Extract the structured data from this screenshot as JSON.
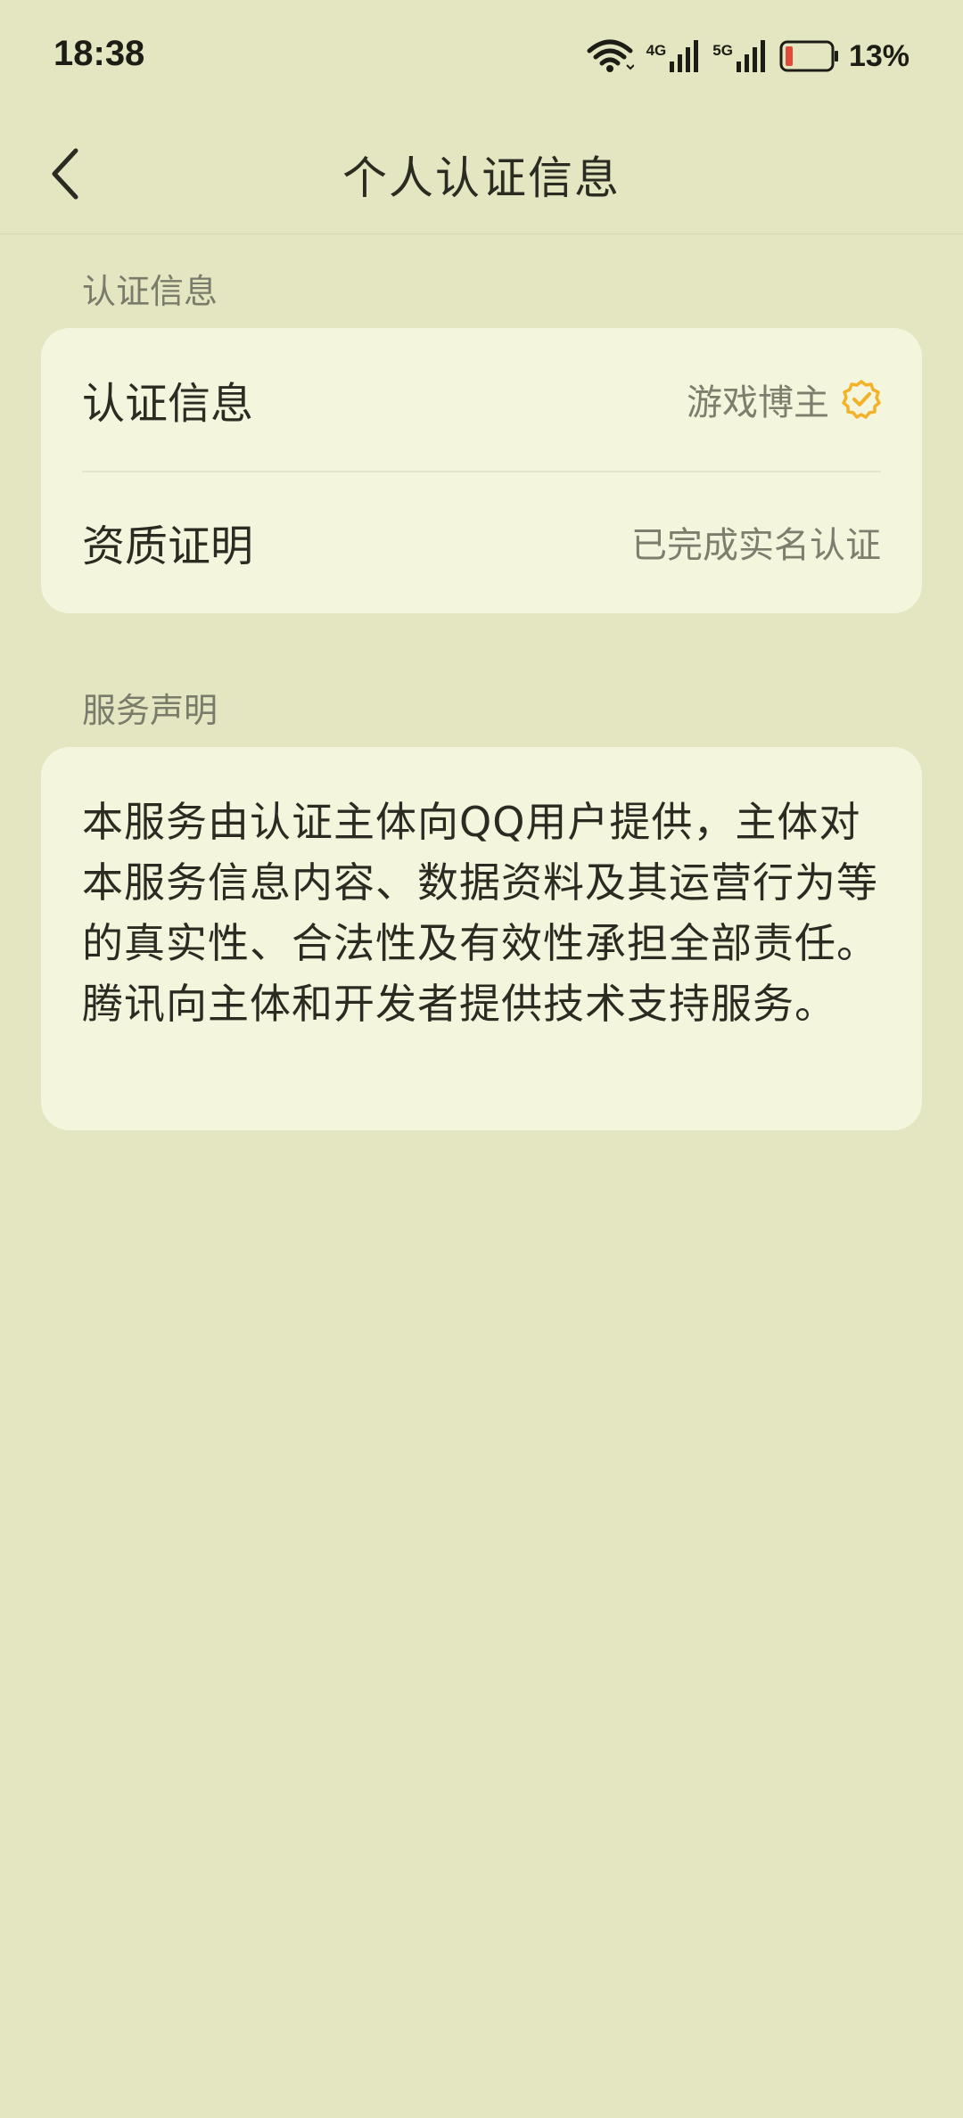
{
  "status_bar": {
    "time": "18:38",
    "net_4g": "4G",
    "net_5g": "5G",
    "battery_percent": "13%",
    "icons": [
      "wifi-icon",
      "cell-signal-4g-icon",
      "cell-signal-5g-icon",
      "battery-low-icon"
    ]
  },
  "nav": {
    "title": "个人认证信息",
    "back_icon": "chevron-left-icon"
  },
  "certification_section": {
    "label": "认证信息",
    "rows": [
      {
        "label": "认证信息",
        "value": "游戏博主",
        "icon": "verified-badge-icon"
      },
      {
        "label": "资质证明",
        "value": "已完成实名认证"
      }
    ]
  },
  "service_section": {
    "label": "服务声明",
    "text": "本服务由认证主体向QQ用户提供，主体对本服务信息内容、数据资料及其运营行为等的真实性、合法性及有效性承担全部责任。腾讯向主体和开发者提供技术支持服务。"
  },
  "colors": {
    "background": "#e4e6c1",
    "card": "#f4f5dd",
    "badge": "#f2b22a",
    "battery_low": "#e04a3a"
  }
}
